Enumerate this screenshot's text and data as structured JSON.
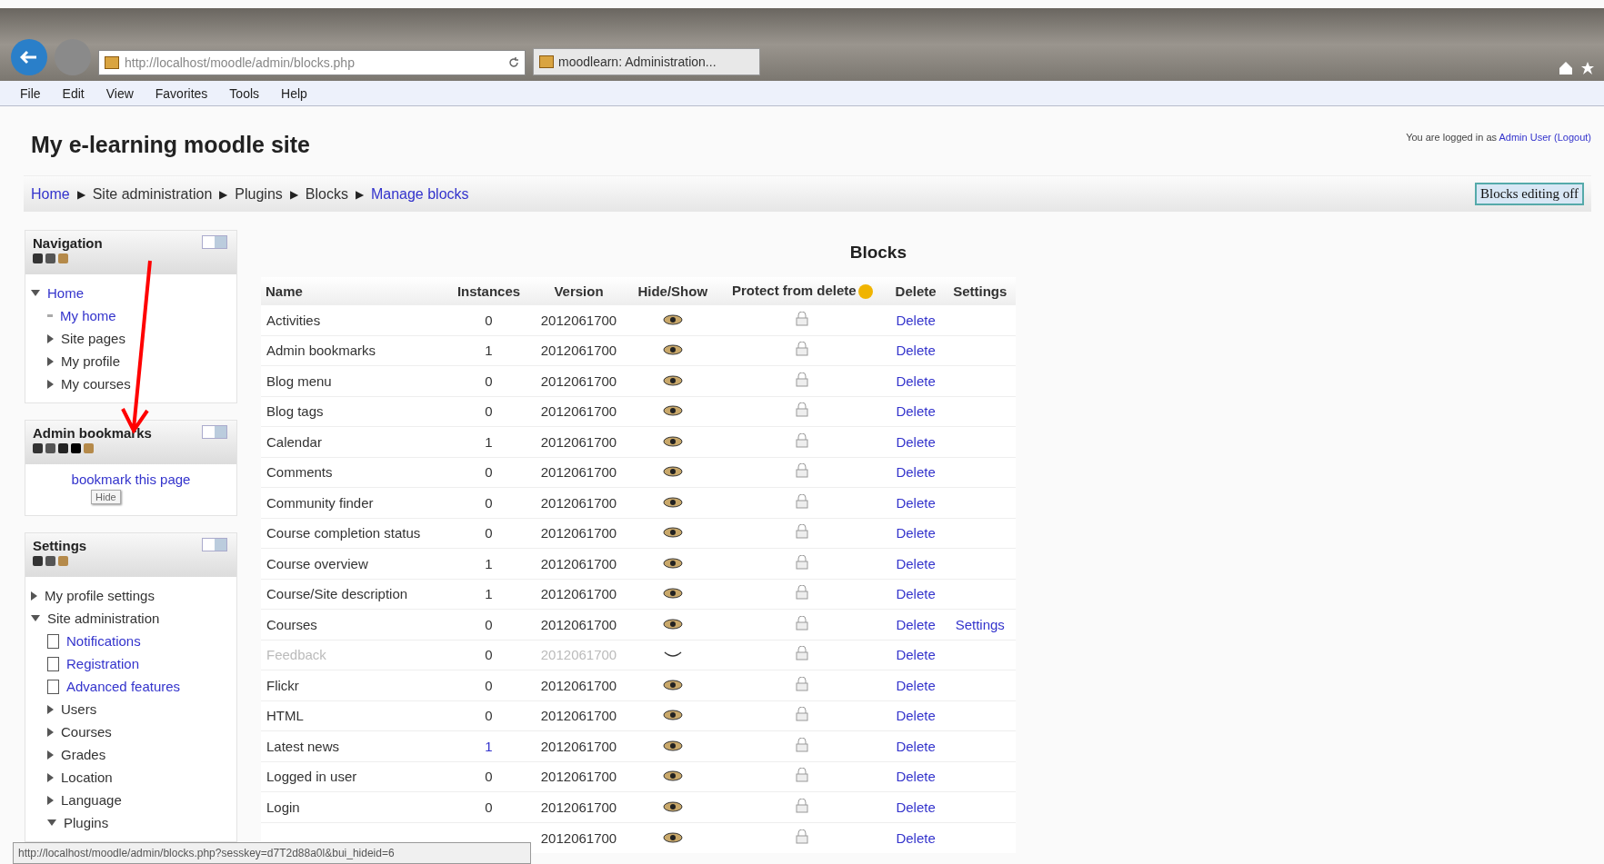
{
  "browser": {
    "address": "http://localhost/moodle/admin/blocks.php",
    "tab_title": "moodlearn: Administration...",
    "menu": [
      "File",
      "Edit",
      "View",
      "Favorites",
      "Tools",
      "Help"
    ]
  },
  "header": {
    "site_title": "My e-learning moodle site",
    "login_text": "You are logged in as",
    "login_user": "Admin User",
    "logout": "(Logout)"
  },
  "breadcrumb": [
    {
      "label": "Home",
      "kind": "link"
    },
    {
      "label": "▶",
      "kind": "separator"
    },
    {
      "label": "Site administration",
      "kind": "text"
    },
    {
      "label": "▶",
      "kind": "separator"
    },
    {
      "label": "Plugins",
      "kind": "text"
    },
    {
      "label": "▶",
      "kind": "separator"
    },
    {
      "label": "Blocks",
      "kind": "text"
    },
    {
      "label": "▶",
      "kind": "separator"
    },
    {
      "label": "Manage blocks",
      "kind": "link"
    }
  ],
  "editing_button": "Blocks editing off",
  "sidebar": [
    {
      "title": "Navigation",
      "kind": "nav",
      "items": [
        {
          "label": "Home",
          "kind": "link",
          "expanded": true,
          "children": [
            {
              "label": "My home",
              "kind": "link"
            },
            {
              "label": "Site pages",
              "kind": "text",
              "expanded": false
            },
            {
              "label": "My profile",
              "kind": "text",
              "expanded": false
            },
            {
              "label": "My courses",
              "kind": "text",
              "expanded": false
            }
          ]
        }
      ]
    },
    {
      "title": "Admin bookmarks",
      "kind": "bookmarks",
      "link": "bookmark this page",
      "tooltip": "Hide"
    },
    {
      "title": "Settings",
      "kind": "nav",
      "items": [
        {
          "label": "My profile settings",
          "kind": "text",
          "expanded": false
        },
        {
          "label": "Site administration",
          "kind": "text",
          "expanded": true,
          "children": [
            {
              "label": "Notifications",
              "kind": "page"
            },
            {
              "label": "Registration",
              "kind": "page"
            },
            {
              "label": "Advanced features",
              "kind": "page"
            },
            {
              "label": "Users",
              "kind": "text",
              "expanded": false
            },
            {
              "label": "Courses",
              "kind": "text",
              "expanded": false
            },
            {
              "label": "Grades",
              "kind": "text",
              "expanded": false
            },
            {
              "label": "Location",
              "kind": "text",
              "expanded": false
            },
            {
              "label": "Language",
              "kind": "text",
              "expanded": false
            },
            {
              "label": "Plugins",
              "kind": "text",
              "expanded": true
            }
          ]
        }
      ]
    }
  ],
  "table": {
    "title": "Blocks",
    "columns": [
      "Name",
      "Instances",
      "Version",
      "Hide/Show",
      "Protect from delete",
      "Delete",
      "Settings"
    ],
    "rows": [
      {
        "name": "Activities",
        "instances": "0",
        "instances_link": false,
        "version": "2012061700",
        "visible": true,
        "delete": "Delete"
      },
      {
        "name": "Admin bookmarks",
        "instances": "1",
        "instances_link": false,
        "version": "2012061700",
        "visible": true,
        "delete": "Delete"
      },
      {
        "name": "Blog menu",
        "instances": "0",
        "instances_link": false,
        "version": "2012061700",
        "visible": true,
        "delete": "Delete"
      },
      {
        "name": "Blog tags",
        "instances": "0",
        "instances_link": false,
        "version": "2012061700",
        "visible": true,
        "delete": "Delete"
      },
      {
        "name": "Calendar",
        "instances": "1",
        "instances_link": false,
        "version": "2012061700",
        "visible": true,
        "delete": "Delete"
      },
      {
        "name": "Comments",
        "instances": "0",
        "instances_link": false,
        "version": "2012061700",
        "visible": true,
        "delete": "Delete"
      },
      {
        "name": "Community finder",
        "instances": "0",
        "instances_link": false,
        "version": "2012061700",
        "visible": true,
        "delete": "Delete"
      },
      {
        "name": "Course completion status",
        "instances": "0",
        "instances_link": false,
        "version": "2012061700",
        "visible": true,
        "delete": "Delete"
      },
      {
        "name": "Course overview",
        "instances": "1",
        "instances_link": false,
        "version": "2012061700",
        "visible": true,
        "delete": "Delete"
      },
      {
        "name": "Course/Site description",
        "instances": "1",
        "instances_link": false,
        "version": "2012061700",
        "visible": true,
        "delete": "Delete"
      },
      {
        "name": "Courses",
        "instances": "0",
        "instances_link": false,
        "version": "2012061700",
        "visible": true,
        "delete": "Delete",
        "settings": "Settings"
      },
      {
        "name": "Feedback",
        "instances": "0",
        "instances_link": false,
        "version": "2012061700",
        "visible": false,
        "delete": "Delete"
      },
      {
        "name": "Flickr",
        "instances": "0",
        "instances_link": false,
        "version": "2012061700",
        "visible": true,
        "delete": "Delete"
      },
      {
        "name": "HTML",
        "instances": "0",
        "instances_link": false,
        "version": "2012061700",
        "visible": true,
        "delete": "Delete"
      },
      {
        "name": "Latest news",
        "instances": "1",
        "instances_link": true,
        "version": "2012061700",
        "visible": true,
        "delete": "Delete"
      },
      {
        "name": "Logged in user",
        "instances": "0",
        "instances_link": false,
        "version": "2012061700",
        "visible": true,
        "delete": "Delete"
      },
      {
        "name": "Login",
        "instances": "0",
        "instances_link": false,
        "version": "2012061700",
        "visible": true,
        "delete": "Delete"
      },
      {
        "version": "2012061700",
        "visible": true,
        "delete": "Delete"
      }
    ]
  },
  "status_url": "http://localhost/moodle/admin/blocks.php?sesskey=d7T2d88a0l&bui_hideid=6"
}
